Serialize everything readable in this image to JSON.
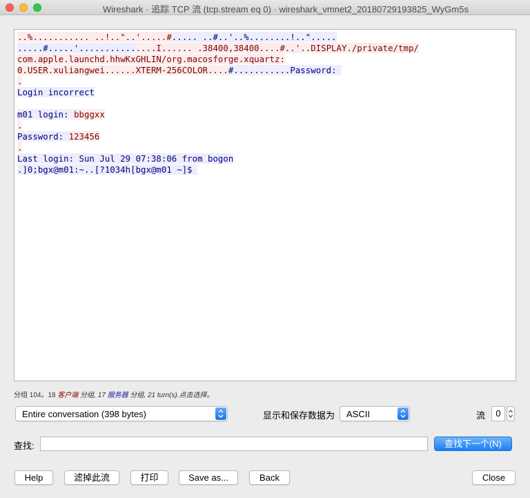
{
  "window": {
    "title": "Wireshark · 追踪 TCP 流 (tcp.stream eq 0) · wireshark_vmnet2_20180729193825_WyGm5s"
  },
  "stream": {
    "colors": {
      "client_fg": "#7f0000",
      "client_bg": "#fbeded",
      "server_fg": "#00007f",
      "server_bg": "#ededfb"
    },
    "lines": [
      [
        {
          "dir": "client",
          "text": "..%........... ..!..\"..'.....#"
        },
        {
          "dir": "server",
          "text": "..... ..#..'..%........!..\"....."
        }
      ],
      [
        {
          "dir": "server",
          "text": ".....#.....'..........."
        },
        {
          "dir": "client",
          "text": "....I...... .38400,38400....#..'..DISPLAY./private/tmp/"
        }
      ],
      [
        {
          "dir": "client",
          "text": "com.apple.launchd.hhwKxGHLIN/org.macosforge.xquartz:"
        }
      ],
      [
        {
          "dir": "client",
          "text": "0.USER.xuliangwei......XTERM-256COLOR...."
        },
        {
          "dir": "server",
          "text": "#..........."
        },
        {
          "dir": "server",
          "text": "Password: "
        }
      ],
      [
        {
          "dir": "client",
          "text": "."
        }
      ],
      [
        {
          "dir": "server",
          "text": "Login incorrect"
        }
      ],
      [],
      [
        {
          "dir": "server",
          "text": "m01 login: "
        },
        {
          "dir": "client",
          "text": "bbggxx"
        }
      ],
      [
        {
          "dir": "client",
          "text": "."
        }
      ],
      [
        {
          "dir": "server",
          "text": "Password: "
        },
        {
          "dir": "client",
          "text": "123456"
        }
      ],
      [
        {
          "dir": "client",
          "text": "."
        }
      ],
      [
        {
          "dir": "server",
          "text": "Last login: Sun Jul 29 07:38:06 from bogon"
        }
      ],
      [
        {
          "dir": "server",
          "text": ".]0;bgx@m01:~..[?1034h[bgx@m01 ~]$ "
        }
      ]
    ]
  },
  "status": {
    "part1": "分组 104。18 ",
    "client_label": "客户端",
    "part2": " 分组, 17 ",
    "server_label": "服务器",
    "part3": " 分组, 21 turn(s).点击选择。"
  },
  "conversation_select": {
    "value": "Entire conversation (398 bytes)"
  },
  "format": {
    "label": "显示和保存数据为",
    "value": "ASCII"
  },
  "stream_index": {
    "label": "流",
    "value": "0"
  },
  "find": {
    "label": "查找:",
    "value": "",
    "next_button": "查找下一个(N)"
  },
  "buttons": {
    "help": "Help",
    "filter_out": "滤掉此流",
    "print": "打印",
    "save_as": "Save as...",
    "back": "Back",
    "close": "Close"
  }
}
